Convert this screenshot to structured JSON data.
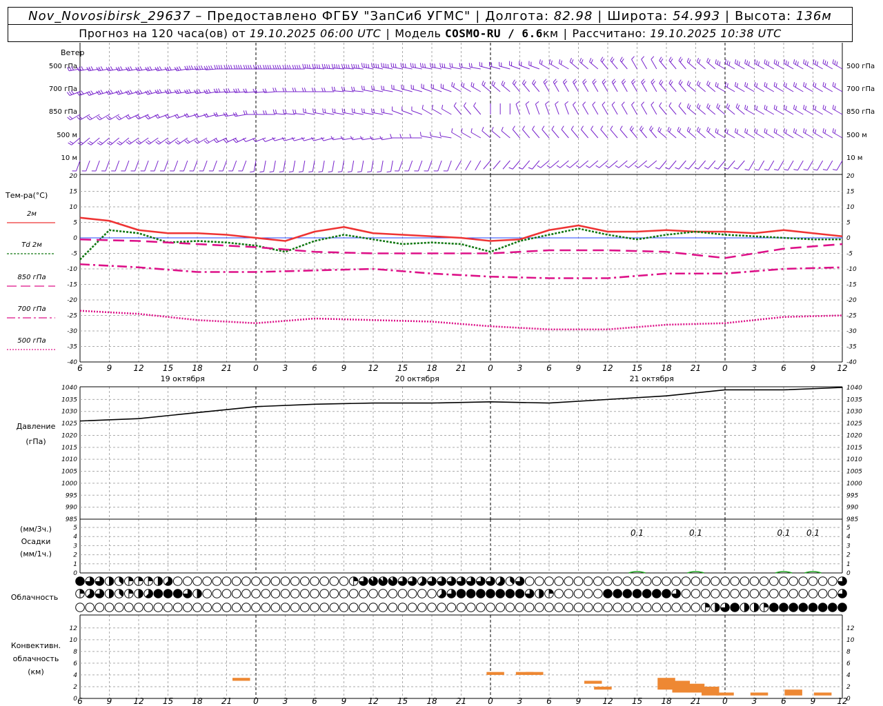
{
  "header": {
    "station": "Nov_Novosibirsk_29637",
    "provider": "– Предоставлено ФГБУ \"ЗапСиб УГМС\"",
    "lon_label": "Долгота:",
    "lon_value": "82.98",
    "lat_label": "Широта:",
    "lat_value": "54.993",
    "alt_label": "Высота:",
    "alt_value": "136м",
    "forecast_text": "Прогноз на 120 часа(ов) от",
    "forecast_start": "19.10.2025 06:00 UTC",
    "model_label": "Модель",
    "model_value": "COSMO-RU / 6.6",
    "model_unit": "км",
    "computed_label": "Рассчитано:",
    "computed_value": "19.10.2025 10:38 UTC"
  },
  "wind": {
    "title": "Ветер",
    "levels": [
      "500 гПа",
      "700 гПа",
      "850 гПа",
      "500  м",
      "10   м"
    ]
  },
  "temperature": {
    "title": "Тем-ра(°С)",
    "legend": [
      {
        "label": "2м",
        "color": "#ee3333",
        "style": "solid"
      },
      {
        "label": "Td  2м",
        "color": "#117711",
        "style": "dotted"
      },
      {
        "label": "850 гПа",
        "color": "#dd1188",
        "style": "dash"
      },
      {
        "label": "700 гПа",
        "color": "#dd1188",
        "style": "dashdot"
      },
      {
        "label": "500 гПа",
        "color": "#dd1188",
        "style": "dot"
      }
    ],
    "ticks": [
      20,
      15,
      10,
      5,
      0,
      -5,
      -10,
      -15,
      -20,
      -25,
      -30,
      -35,
      -40
    ]
  },
  "time_axis": {
    "hour_labels": [
      "6",
      "9",
      "12",
      "15",
      "18",
      "21",
      "0",
      "3",
      "6",
      "9",
      "12",
      "15",
      "18",
      "21",
      "0",
      "3",
      "6",
      "9",
      "12",
      "15",
      "18",
      "21",
      "0",
      "3",
      "6",
      "9",
      "12"
    ],
    "day_labels": [
      "19 октября",
      "20 октября",
      "21 октября"
    ]
  },
  "pressure": {
    "title": "Давление",
    "unit": "(гПа)",
    "ticks": [
      1040,
      1035,
      1030,
      1025,
      1020,
      1015,
      1010,
      1005,
      1000,
      995,
      990,
      985
    ]
  },
  "precip": {
    "unit3": "(мм/3ч.)",
    "title": "Осадки",
    "unit1": "(мм/1ч.)",
    "ticks": [
      5,
      4,
      3,
      2,
      1,
      0
    ],
    "labels": [
      {
        "hour": 57,
        "text": "0.1"
      },
      {
        "hour": 63,
        "text": "0.1"
      },
      {
        "hour": 72,
        "text": "0.1"
      },
      {
        "hour": 75,
        "text": "0.1"
      }
    ]
  },
  "cloud": {
    "title": "Облачность"
  },
  "convective": {
    "title1": "Конвективн.",
    "title2": "облачность",
    "unit": "(км)",
    "ticks": [
      12,
      10,
      8,
      6,
      4,
      2,
      0
    ],
    "color": "#ee8833"
  },
  "chart_data": {
    "type": "line",
    "x_unit": "hours since 19.10.2025 06:00 UTC",
    "series": [
      {
        "name": "2м",
        "x": [
          0,
          3,
          6,
          9,
          12,
          15,
          18,
          21,
          24,
          27,
          30,
          33,
          36,
          39,
          42,
          45,
          48,
          51,
          54,
          57,
          60,
          63,
          66,
          69,
          72,
          75,
          78
        ],
        "values": [
          6.5,
          5.5,
          2.5,
          1.5,
          1.5,
          1.0,
          0,
          -1.0,
          2.0,
          3.5,
          1.5,
          1.0,
          0.5,
          0,
          -1.0,
          -0.5,
          2.5,
          4.0,
          2.0,
          2.0,
          2.5,
          2.0,
          2.0,
          1.5,
          2.5,
          1.5,
          0.5
        ]
      },
      {
        "name": "Td  2м",
        "x": [
          0,
          3,
          6,
          9,
          12,
          15,
          18,
          21,
          24,
          27,
          30,
          33,
          36,
          39,
          42,
          45,
          48,
          51,
          54,
          57,
          60,
          63,
          66,
          69,
          72,
          75,
          78
        ],
        "values": [
          -7.0,
          2.5,
          1.5,
          -1.5,
          -1.0,
          -1.5,
          -2.5,
          -4.5,
          -1.0,
          1.0,
          -0.5,
          -2.0,
          -1.5,
          -2.0,
          -4.5,
          -1.0,
          1.0,
          3.0,
          1.0,
          -0.5,
          1.0,
          2.0,
          1.0,
          0.5,
          0,
          -0.5,
          -0.5
        ]
      },
      {
        "name": "850 гПа",
        "x": [
          0,
          6,
          12,
          18,
          24,
          30,
          36,
          42,
          48,
          54,
          60,
          66,
          72,
          78
        ],
        "values": [
          -0.5,
          -1.0,
          -2.0,
          -3.0,
          -4.5,
          -5.0,
          -5.0,
          -5.0,
          -4.0,
          -4.0,
          -4.5,
          -6.5,
          -3.5,
          -2.0
        ]
      },
      {
        "name": "700 гПа",
        "x": [
          0,
          6,
          12,
          18,
          24,
          30,
          36,
          42,
          48,
          54,
          60,
          66,
          72,
          78
        ],
        "values": [
          -8.5,
          -9.5,
          -11.0,
          -11.0,
          -10.5,
          -10.0,
          -11.5,
          -12.5,
          -13.0,
          -13.0,
          -11.5,
          -11.5,
          -10.0,
          -9.5
        ]
      },
      {
        "name": "500 гПа",
        "x": [
          0,
          6,
          12,
          18,
          24,
          30,
          36,
          42,
          48,
          54,
          60,
          66,
          72,
          78
        ],
        "values": [
          -23.5,
          -24.5,
          -26.5,
          -27.5,
          -26.0,
          -26.5,
          -27.0,
          -28.5,
          -29.5,
          -29.5,
          -28.0,
          -27.5,
          -25.5,
          -25.0
        ]
      },
      {
        "name": "Давление",
        "x": [
          0,
          6,
          12,
          18,
          24,
          30,
          36,
          42,
          48,
          54,
          60,
          66,
          72,
          78
        ],
        "values": [
          1026.0,
          1027.0,
          1029.5,
          1032.0,
          1033.0,
          1033.5,
          1033.5,
          1034.0,
          1033.5,
          1035.0,
          1036.5,
          1039.0,
          1039.0,
          1040.0
        ]
      }
    ],
    "precip_bars": [
      {
        "x": 57,
        "value": 0.1
      },
      {
        "x": 63,
        "value": 0.1
      },
      {
        "x": 72,
        "value": 0.1
      },
      {
        "x": 75,
        "value": 0.1
      }
    ],
    "cloud_cover_octas": {
      "comment_free_rows": true,
      "high": [
        8,
        6,
        6,
        4,
        3,
        2,
        2,
        2,
        4,
        5,
        0,
        0,
        0,
        0,
        0,
        0,
        0,
        0,
        0,
        0,
        0,
        0,
        0,
        0,
        0,
        0,
        0,
        0,
        2,
        6,
        7,
        7,
        7,
        6,
        6,
        5,
        6,
        6,
        6,
        6,
        6,
        6,
        6,
        5,
        3,
        6,
        0,
        0,
        0,
        0,
        0,
        0,
        0,
        0,
        0,
        0,
        0,
        0,
        0,
        0,
        0,
        0,
        0,
        0,
        0,
        0,
        0,
        0,
        0,
        0,
        0,
        0,
        0,
        0,
        0,
        0,
        0,
        0,
        6
      ],
      "middle": [
        2,
        5,
        6,
        4,
        3,
        2,
        4,
        5,
        8,
        8,
        8,
        6,
        4,
        0,
        0,
        0,
        0,
        0,
        0,
        0,
        0,
        0,
        0,
        0,
        0,
        0,
        0,
        0,
        0,
        0,
        0,
        0,
        0,
        0,
        0,
        0,
        0,
        5,
        6,
        8,
        8,
        8,
        8,
        8,
        8,
        8,
        6,
        4,
        2,
        0,
        0,
        0,
        0,
        0,
        8,
        8,
        8,
        8,
        8,
        8,
        8,
        6,
        0,
        0,
        0,
        0,
        0,
        0,
        0,
        0,
        0,
        0,
        0,
        0,
        0,
        0,
        0,
        0,
        6
      ],
      "low": [
        0,
        0,
        0,
        0,
        0,
        0,
        0,
        0,
        0,
        0,
        0,
        0,
        0,
        0,
        0,
        0,
        0,
        0,
        0,
        0,
        0,
        0,
        0,
        0,
        0,
        0,
        0,
        0,
        0,
        0,
        0,
        0,
        0,
        0,
        0,
        0,
        0,
        0,
        0,
        0,
        0,
        0,
        0,
        0,
        0,
        0,
        0,
        0,
        0,
        0,
        0,
        0,
        0,
        0,
        0,
        0,
        0,
        0,
        0,
        0,
        0,
        0,
        0,
        0,
        2,
        4,
        6,
        8,
        4,
        4,
        2,
        8,
        8,
        8,
        8,
        8,
        8,
        8,
        8
      ]
    },
    "convective_km": [
      {
        "x": 16.5,
        "bottom": 3.0,
        "top": 3.5
      },
      {
        "x": 42.5,
        "bottom": 4.0,
        "top": 4.5
      },
      {
        "x": 45.5,
        "bottom": 4.0,
        "top": 4.5
      },
      {
        "x": 46.5,
        "bottom": 4.0,
        "top": 4.5
      },
      {
        "x": 52.5,
        "bottom": 2.5,
        "top": 3.0
      },
      {
        "x": 53.5,
        "bottom": 1.5,
        "top": 2.0
      },
      {
        "x": 60.0,
        "bottom": 1.5,
        "top": 3.5
      },
      {
        "x": 61.5,
        "bottom": 1.0,
        "top": 3.0
      },
      {
        "x": 63.0,
        "bottom": 1.0,
        "top": 2.5
      },
      {
        "x": 64.5,
        "bottom": 0.5,
        "top": 2.0
      },
      {
        "x": 66.0,
        "bottom": 0.5,
        "top": 1.0
      },
      {
        "x": 69.5,
        "bottom": 0.5,
        "top": 1.0
      },
      {
        "x": 73.0,
        "bottom": 0.5,
        "top": 1.5
      },
      {
        "x": 76.0,
        "bottom": 0.5,
        "top": 1.0
      }
    ],
    "wind_rows": [
      {
        "level": "500 гПа",
        "speed": [
          14,
          16,
          16,
          16,
          18,
          18,
          20,
          20,
          20,
          18,
          18,
          16,
          16,
          12,
          10,
          10,
          8,
          10,
          10,
          6,
          8,
          12,
          14,
          14,
          14,
          14,
          14
        ],
        "dir": [
          260,
          260,
          260,
          260,
          265,
          270,
          270,
          270,
          275,
          275,
          280,
          280,
          280,
          280,
          285,
          290,
          300,
          310,
          320,
          330,
          320,
          310,
          300,
          300,
          300,
          300,
          300
        ]
      },
      {
        "level": "700 гПа",
        "speed": [
          14,
          14,
          14,
          14,
          14,
          14,
          12,
          12,
          12,
          12,
          12,
          12,
          12,
          10,
          10,
          10,
          10,
          10,
          10,
          8,
          8,
          10,
          10,
          10,
          10,
          10,
          10
        ],
        "dir": [
          250,
          255,
          255,
          260,
          260,
          265,
          265,
          270,
          270,
          275,
          280,
          285,
          290,
          300,
          310,
          320,
          330,
          330,
          330,
          330,
          320,
          310,
          300,
          300,
          300,
          300,
          300
        ]
      },
      {
        "level": "850 гПа",
        "speed": [
          10,
          10,
          12,
          12,
          12,
          10,
          10,
          10,
          8,
          8,
          8,
          6,
          6,
          4,
          2,
          4,
          4,
          6,
          6,
          6,
          6,
          8,
          8,
          8,
          8,
          8,
          8
        ],
        "dir": [
          240,
          240,
          245,
          250,
          255,
          260,
          270,
          275,
          280,
          280,
          280,
          290,
          300,
          320,
          0,
          340,
          340,
          330,
          330,
          330,
          320,
          310,
          310,
          300,
          300,
          300,
          300
        ]
      },
      {
        "level": "500  м",
        "speed": [
          8,
          8,
          8,
          8,
          8,
          8,
          6,
          6,
          6,
          6,
          6,
          6,
          4,
          4,
          4,
          6,
          6,
          6,
          6,
          8,
          8,
          8,
          8,
          8,
          8,
          8,
          8
        ],
        "dir": [
          230,
          230,
          235,
          235,
          240,
          245,
          250,
          255,
          255,
          260,
          260,
          270,
          280,
          300,
          310,
          320,
          320,
          320,
          320,
          320,
          310,
          310,
          300,
          300,
          300,
          300,
          300
        ]
      },
      {
        "level": "10   м",
        "speed": [
          4,
          4,
          4,
          4,
          4,
          4,
          3,
          3,
          3,
          3,
          3,
          3,
          3,
          2,
          2,
          3,
          3,
          3,
          3,
          3,
          3,
          4,
          4,
          4,
          4,
          4,
          4
        ],
        "dir": [
          200,
          200,
          200,
          200,
          200,
          200,
          190,
          190,
          190,
          190,
          190,
          200,
          200,
          210,
          220,
          220,
          230,
          230,
          230,
          230,
          220,
          220,
          220,
          210,
          210,
          210,
          210
        ]
      }
    ]
  }
}
